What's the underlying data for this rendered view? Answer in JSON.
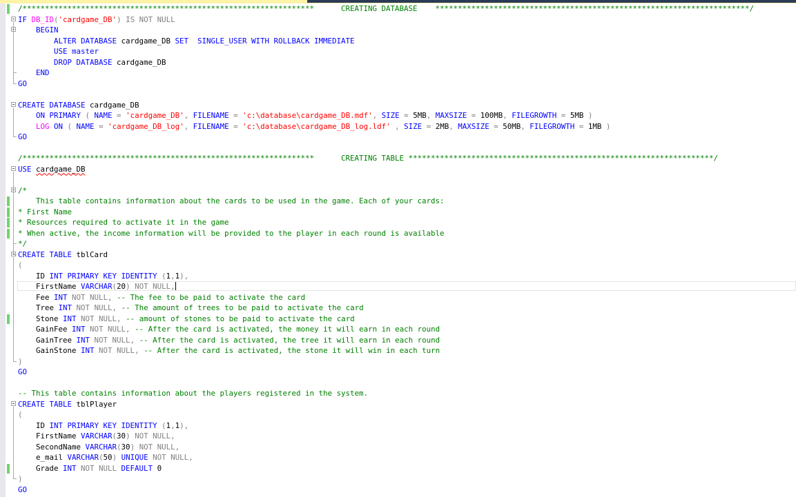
{
  "window": {
    "tab_bar_colors": {
      "active_tab": "#fdf3a7",
      "inactive_area": "#2b3a55"
    }
  },
  "editor": {
    "syntax_colors": {
      "keyword": "#0000ff",
      "function": "#ff00ff",
      "string": "#ff0000",
      "comment": "#008000",
      "operator": "#808080"
    },
    "lines": [
      {
        "segs": [
          {
            "t": "/*****************************************************************      CREATING DATABASE    **********************************************************************/",
            "c": "cm"
          }
        ],
        "chg": true
      },
      {
        "segs": [
          {
            "t": "IF ",
            "c": "kw"
          },
          {
            "t": "DB_ID",
            "c": "fn"
          },
          {
            "t": "(",
            "c": "gr"
          },
          {
            "t": "'cardgame_DB'",
            "c": "str"
          },
          {
            "t": ") ",
            "c": "gr"
          },
          {
            "t": "IS NOT NULL",
            "c": "gr"
          }
        ],
        "fold": true
      },
      {
        "segs": [
          {
            "t": "    BEGIN",
            "c": "kw"
          }
        ],
        "fold": true
      },
      {
        "segs": [
          {
            "t": "        ALTER DATABASE ",
            "c": "kw"
          },
          {
            "t": "cardgame_DB ",
            "c": ""
          },
          {
            "t": "SET  SINGLE_USER WITH ROLLBACK IMMEDIATE",
            "c": "kw"
          }
        ]
      },
      {
        "segs": [
          {
            "t": "        USE ",
            "c": "kw"
          },
          {
            "t": "master",
            "c": "kw"
          }
        ]
      },
      {
        "segs": [
          {
            "t": "        DROP DATABASE ",
            "c": "kw"
          },
          {
            "t": "cardgame_DB",
            "c": ""
          }
        ]
      },
      {
        "segs": [
          {
            "t": "    END",
            "c": "kw"
          }
        ]
      },
      {
        "segs": [
          {
            "t": "GO",
            "c": "kw"
          }
        ]
      },
      {
        "segs": []
      },
      {
        "segs": [
          {
            "t": "CREATE DATABASE ",
            "c": "kw"
          },
          {
            "t": "cardgame_DB",
            "c": ""
          }
        ],
        "fold": true
      },
      {
        "segs": [
          {
            "t": "    ON PRIMARY ",
            "c": "kw"
          },
          {
            "t": "( ",
            "c": "gr"
          },
          {
            "t": "NAME ",
            "c": "kw"
          },
          {
            "t": "= ",
            "c": "gr"
          },
          {
            "t": "'cardgame_DB'",
            "c": "str"
          },
          {
            "t": ", ",
            "c": "gr"
          },
          {
            "t": "FILENAME ",
            "c": "kw"
          },
          {
            "t": "= ",
            "c": "gr"
          },
          {
            "t": "'c:\\database\\cardgame_DB.mdf'",
            "c": "str"
          },
          {
            "t": ", ",
            "c": "gr"
          },
          {
            "t": "SIZE ",
            "c": "kw"
          },
          {
            "t": "= ",
            "c": "gr"
          },
          {
            "t": "5MB",
            "c": ""
          },
          {
            "t": ", ",
            "c": "gr"
          },
          {
            "t": "MAXSIZE ",
            "c": "kw"
          },
          {
            "t": "= ",
            "c": "gr"
          },
          {
            "t": "100MB",
            "c": ""
          },
          {
            "t": ", ",
            "c": "gr"
          },
          {
            "t": "FILEGROWTH ",
            "c": "kw"
          },
          {
            "t": "= ",
            "c": "gr"
          },
          {
            "t": "5MB ",
            "c": ""
          },
          {
            "t": ")",
            "c": "gr"
          }
        ]
      },
      {
        "segs": [
          {
            "t": "    LOG ",
            "c": "fn"
          },
          {
            "t": "ON ",
            "c": "kw"
          },
          {
            "t": "( ",
            "c": "gr"
          },
          {
            "t": "NAME ",
            "c": "kw"
          },
          {
            "t": "= ",
            "c": "gr"
          },
          {
            "t": "'cardgame_DB_log'",
            "c": "str"
          },
          {
            "t": ", ",
            "c": "gr"
          },
          {
            "t": "FILENAME ",
            "c": "kw"
          },
          {
            "t": "= ",
            "c": "gr"
          },
          {
            "t": "'c:\\database\\cardgame_DB_log.ldf'",
            "c": "str"
          },
          {
            "t": " , ",
            "c": "gr"
          },
          {
            "t": "SIZE ",
            "c": "kw"
          },
          {
            "t": "= ",
            "c": "gr"
          },
          {
            "t": "2MB",
            "c": ""
          },
          {
            "t": ", ",
            "c": "gr"
          },
          {
            "t": "MAXSIZE ",
            "c": "kw"
          },
          {
            "t": "= ",
            "c": "gr"
          },
          {
            "t": "50MB",
            "c": ""
          },
          {
            "t": ", ",
            "c": "gr"
          },
          {
            "t": "FILEGROWTH ",
            "c": "kw"
          },
          {
            "t": "= ",
            "c": "gr"
          },
          {
            "t": "1MB ",
            "c": ""
          },
          {
            "t": ")",
            "c": "gr"
          }
        ]
      },
      {
        "segs": [
          {
            "t": "GO",
            "c": "kw"
          }
        ]
      },
      {
        "segs": []
      },
      {
        "segs": [
          {
            "t": "/*****************************************************************      CREATING TABLE ********************************************************************/",
            "c": "cm"
          }
        ]
      },
      {
        "segs": [
          {
            "t": "USE ",
            "c": "kw"
          },
          {
            "t": "cardgame_DB",
            "c": "squiggle"
          }
        ],
        "fold": true
      },
      {
        "segs": []
      },
      {
        "segs": [
          {
            "t": "/*",
            "c": "cm"
          }
        ],
        "fold": true
      },
      {
        "segs": [
          {
            "t": "    This table contains information about the cards to be used in the game. Each of your cards:",
            "c": "cm"
          }
        ],
        "chg": true
      },
      {
        "segs": [
          {
            "t": "* First Name",
            "c": "cm"
          }
        ],
        "chg": true
      },
      {
        "segs": [
          {
            "t": "* Resources required to activate it in the game",
            "c": "cm"
          }
        ],
        "chg": true
      },
      {
        "segs": [
          {
            "t": "* When active, the income information will be provided to the player in each round is available",
            "c": "cm"
          }
        ],
        "chg": true
      },
      {
        "segs": [
          {
            "t": "*/",
            "c": "cm"
          }
        ]
      },
      {
        "segs": [
          {
            "t": "CREATE TABLE ",
            "c": "kw"
          },
          {
            "t": "tblCard",
            "c": ""
          }
        ],
        "fold": true
      },
      {
        "segs": [
          {
            "t": "(",
            "c": "gr"
          }
        ]
      },
      {
        "segs": [
          {
            "t": "    ID ",
            "c": ""
          },
          {
            "t": "INT PRIMARY KEY IDENTITY ",
            "c": "kw"
          },
          {
            "t": "(",
            "c": "gr"
          },
          {
            "t": "1",
            "c": ""
          },
          {
            "t": ",",
            "c": "gr"
          },
          {
            "t": "1",
            "c": ""
          },
          {
            "t": "),",
            "c": "gr"
          }
        ]
      },
      {
        "segs": [
          {
            "t": "    FirstName ",
            "c": ""
          },
          {
            "t": "VARCHAR",
            "c": "kw"
          },
          {
            "t": "(",
            "c": "gr"
          },
          {
            "t": "20",
            "c": ""
          },
          {
            "t": ") ",
            "c": "gr"
          },
          {
            "t": "NOT NULL",
            "c": "gr"
          },
          {
            "t": ",",
            "c": "gr"
          }
        ],
        "current": true
      },
      {
        "segs": [
          {
            "t": "    Fee ",
            "c": ""
          },
          {
            "t": "INT ",
            "c": "kw"
          },
          {
            "t": "NOT NULL",
            "c": "gr"
          },
          {
            "t": ", ",
            "c": "gr"
          },
          {
            "t": "-- The fee to be paid to activate the card",
            "c": "cm"
          }
        ]
      },
      {
        "segs": [
          {
            "t": "    Tree ",
            "c": ""
          },
          {
            "t": "INT ",
            "c": "kw"
          },
          {
            "t": "NOT NULL",
            "c": "gr"
          },
          {
            "t": ", ",
            "c": "gr"
          },
          {
            "t": "-- The amount of trees to be paid to activate the card",
            "c": "cm"
          }
        ]
      },
      {
        "segs": [
          {
            "t": "    Stone ",
            "c": ""
          },
          {
            "t": "INT ",
            "c": "kw"
          },
          {
            "t": "NOT NULL",
            "c": "gr"
          },
          {
            "t": ", ",
            "c": "gr"
          },
          {
            "t": "-- amount of stones to be paid to activate the card",
            "c": "cm"
          }
        ],
        "chg": true
      },
      {
        "segs": [
          {
            "t": "    GainFee ",
            "c": ""
          },
          {
            "t": "INT ",
            "c": "kw"
          },
          {
            "t": "NOT NULL",
            "c": "gr"
          },
          {
            "t": ", ",
            "c": "gr"
          },
          {
            "t": "-- After the card is activated, the money it will earn in each round",
            "c": "cm"
          }
        ]
      },
      {
        "segs": [
          {
            "t": "    GainTree ",
            "c": ""
          },
          {
            "t": "INT ",
            "c": "kw"
          },
          {
            "t": "NOT NULL",
            "c": "gr"
          },
          {
            "t": ", ",
            "c": "gr"
          },
          {
            "t": "-- After the card is activated, the tree it will earn in each round",
            "c": "cm"
          }
        ]
      },
      {
        "segs": [
          {
            "t": "    GainStone ",
            "c": ""
          },
          {
            "t": "INT ",
            "c": "kw"
          },
          {
            "t": "NOT NULL",
            "c": "gr"
          },
          {
            "t": ", ",
            "c": "gr"
          },
          {
            "t": "-- After the card is activated, the stone it will win in each turn",
            "c": "cm"
          }
        ]
      },
      {
        "segs": [
          {
            "t": ")",
            "c": "gr"
          }
        ]
      },
      {
        "segs": [
          {
            "t": "GO",
            "c": "kw"
          }
        ]
      },
      {
        "segs": []
      },
      {
        "segs": [
          {
            "t": "-- This table contains information about the players registered in the system.",
            "c": "cm"
          }
        ]
      },
      {
        "segs": [
          {
            "t": "CREATE TABLE ",
            "c": "kw"
          },
          {
            "t": "tblPlayer",
            "c": ""
          }
        ],
        "fold": true
      },
      {
        "segs": [
          {
            "t": "(",
            "c": "gr"
          }
        ]
      },
      {
        "segs": [
          {
            "t": "    ID ",
            "c": ""
          },
          {
            "t": "INT PRIMARY KEY IDENTITY ",
            "c": "kw"
          },
          {
            "t": "(",
            "c": "gr"
          },
          {
            "t": "1",
            "c": ""
          },
          {
            "t": ",",
            "c": "gr"
          },
          {
            "t": "1",
            "c": ""
          },
          {
            "t": "),",
            "c": "gr"
          }
        ]
      },
      {
        "segs": [
          {
            "t": "    FirstName ",
            "c": ""
          },
          {
            "t": "VARCHAR",
            "c": "kw"
          },
          {
            "t": "(",
            "c": "gr"
          },
          {
            "t": "30",
            "c": ""
          },
          {
            "t": ") ",
            "c": "gr"
          },
          {
            "t": "NOT NULL",
            "c": "gr"
          },
          {
            "t": ",",
            "c": "gr"
          }
        ]
      },
      {
        "segs": [
          {
            "t": "    SecondName ",
            "c": ""
          },
          {
            "t": "VARCHAR",
            "c": "kw"
          },
          {
            "t": "(",
            "c": "gr"
          },
          {
            "t": "30",
            "c": ""
          },
          {
            "t": ") ",
            "c": "gr"
          },
          {
            "t": "NOT NULL",
            "c": "gr"
          },
          {
            "t": ",",
            "c": "gr"
          }
        ]
      },
      {
        "segs": [
          {
            "t": "    e_mail ",
            "c": ""
          },
          {
            "t": "VARCHAR",
            "c": "kw"
          },
          {
            "t": "(",
            "c": "gr"
          },
          {
            "t": "50",
            "c": ""
          },
          {
            "t": ") ",
            "c": "gr"
          },
          {
            "t": "UNIQUE ",
            "c": "kw"
          },
          {
            "t": "NOT NULL",
            "c": "gr"
          },
          {
            "t": ",",
            "c": "gr"
          }
        ]
      },
      {
        "segs": [
          {
            "t": "    Grade ",
            "c": ""
          },
          {
            "t": "INT ",
            "c": "kw"
          },
          {
            "t": "NOT NULL ",
            "c": "gr"
          },
          {
            "t": "DEFAULT ",
            "c": "kw"
          },
          {
            "t": "0",
            "c": ""
          }
        ],
        "chg": true
      },
      {
        "segs": [
          {
            "t": ")",
            "c": "gr"
          }
        ]
      },
      {
        "segs": [
          {
            "t": "GO",
            "c": "kw"
          }
        ]
      }
    ],
    "fold_regions": [
      {
        "start": 1,
        "end": 7
      },
      {
        "start": 2,
        "end": 6
      },
      {
        "start": 9,
        "end": 12
      },
      {
        "start": 15,
        "end": 23
      },
      {
        "start": 17,
        "end": 22
      },
      {
        "start": 23,
        "end": 33
      },
      {
        "start": 37,
        "end": 44
      }
    ]
  }
}
